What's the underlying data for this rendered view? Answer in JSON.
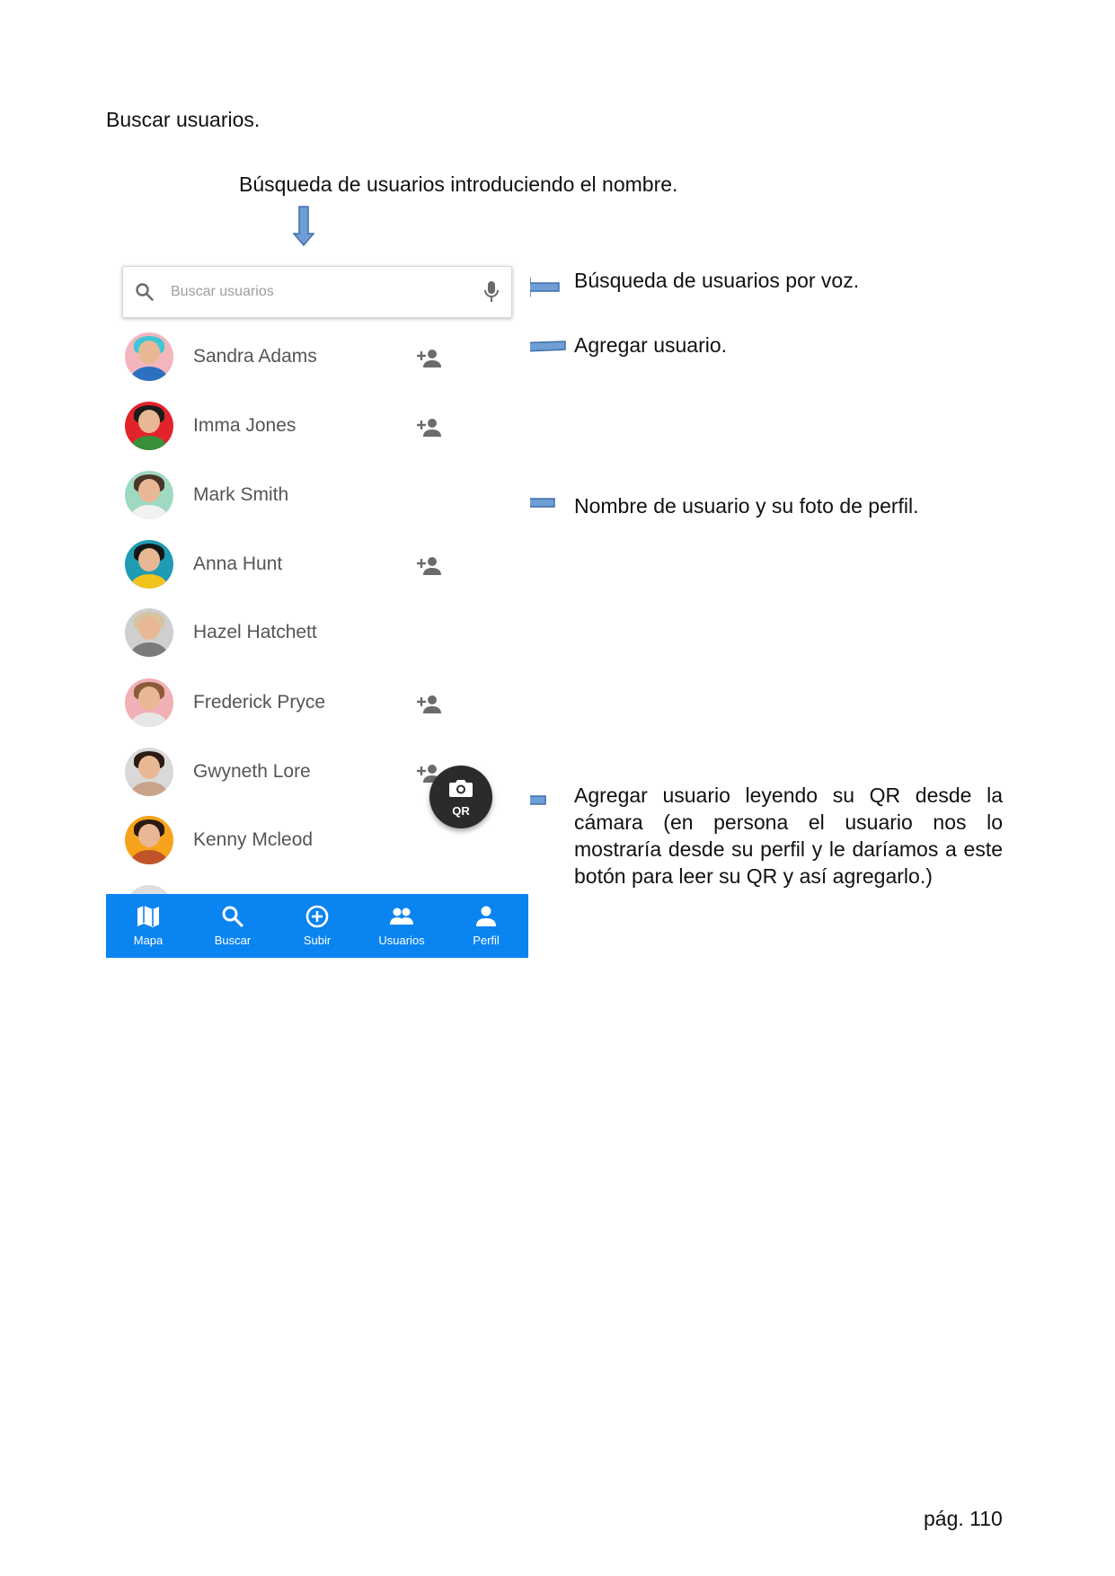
{
  "document": {
    "heading": "Buscar usuarios.",
    "notes": {
      "search_by_name": "Búsqueda de usuarios introduciendo el nombre.",
      "voice_search": "Búsqueda de usuarios por voz.",
      "add_user": "Agregar usuario.",
      "user_name_photo": "Nombre de usuario y su foto de perfil.",
      "add_by_qr": "Agregar usuario leyendo su QR desde la cámara (en persona el usuario nos lo mostraría desde su perfil y le daríamos a este botón para leer su QR y así agregarlo.)"
    },
    "page_number": "pág. 110"
  },
  "search": {
    "placeholder": "Buscar usuarios",
    "search_icon": "search-icon",
    "mic_icon": "mic-icon"
  },
  "users": [
    {
      "name": "Sandra Adams",
      "show_add": true,
      "colors": {
        "bg": "#f3b6bd",
        "hair": "#3ec6d6",
        "body": "#2d6fc0"
      }
    },
    {
      "name": "Imma Jones",
      "show_add": true,
      "colors": {
        "bg": "#e2232a",
        "hair": "#1e1b1b",
        "body": "#3a8f3c"
      }
    },
    {
      "name": "Mark Smith",
      "show_add": false,
      "colors": {
        "bg": "#9fd9c2",
        "hair": "#4a3528",
        "body": "#f2f2f2"
      }
    },
    {
      "name": "Anna Hunt",
      "show_add": true,
      "colors": {
        "bg": "#1f9bb3",
        "hair": "#161616",
        "body": "#f2c31a"
      }
    },
    {
      "name": "Hazel Hatchett",
      "show_add": false,
      "colors": {
        "bg": "#cfcfcf",
        "hair": "#d6c3a0",
        "body": "#7a7a7a"
      }
    },
    {
      "name": "Frederick Pryce",
      "show_add": true,
      "colors": {
        "bg": "#f0b0b6",
        "hair": "#8b5a3a",
        "body": "#e6e6e6"
      }
    },
    {
      "name": "Gwyneth Lore",
      "show_add": true,
      "colors": {
        "bg": "#d9d9d9",
        "hair": "#2a1b14",
        "body": "#c9a28a"
      }
    },
    {
      "name": "Kenny Mcleod",
      "show_add": false,
      "colors": {
        "bg": "#f6a31b",
        "hair": "#2b1a12",
        "body": "#c05428"
      }
    }
  ],
  "fab": {
    "label": "QR",
    "icon": "camera-icon"
  },
  "nav": [
    {
      "label": "Mapa",
      "icon": "map-icon"
    },
    {
      "label": "Buscar",
      "icon": "search-icon"
    },
    {
      "label": "Subir",
      "icon": "add-circle-icon"
    },
    {
      "label": "Usuarios",
      "icon": "people-icon"
    },
    {
      "label": "Perfil",
      "icon": "person-icon"
    }
  ],
  "colors": {
    "nav_bg": "#0a84f0",
    "arrow_fill": "#6f9ed6",
    "arrow_stroke": "#3f6fa8",
    "fab_bg": "#2b2b2b",
    "icon_grey": "#6b6b6b"
  }
}
